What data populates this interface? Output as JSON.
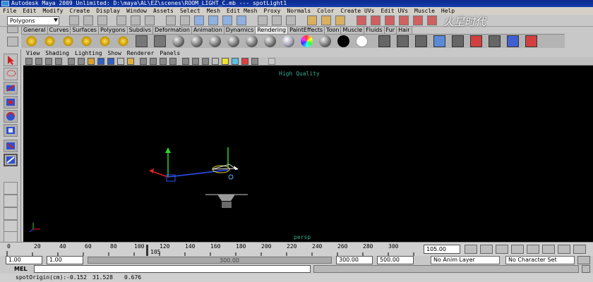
{
  "window": {
    "title": "Autodesk Maya 2009 Unlimited: D:\\maya\\AL\\EZ\\scenes\\ROOM_LIGHT_C.mb    ---    spotLight1"
  },
  "menubar": [
    "File",
    "Edit",
    "Modify",
    "Create",
    "Display",
    "Window",
    "Assets",
    "Select",
    "Mesh",
    "Edit Mesh",
    "Proxy",
    "Normals",
    "Color",
    "Create UVs",
    "Edit UVs",
    "Muscle",
    "Help"
  ],
  "statusline": {
    "mode": "Polygons"
  },
  "shelf": {
    "tabs": [
      "General",
      "Curves",
      "Surfaces",
      "Polygons",
      "Subdivs",
      "Deformation",
      "Animation",
      "Dynamics",
      "Rendering",
      "PaintEffects",
      "Toon",
      "Muscle",
      "Fluids",
      "Fur",
      "Hair"
    ],
    "active_tab": "Rendering"
  },
  "panel": {
    "menu": [
      "View",
      "Shading",
      "Lighting",
      "Show",
      "Renderer",
      "Panels"
    ],
    "renderer_label": "High Quality",
    "camera_label": "persp"
  },
  "timeline": {
    "ticks": [
      "0",
      "20",
      "40",
      "60",
      "80",
      "100",
      "120",
      "140",
      "160",
      "180",
      "200",
      "220",
      "240",
      "260",
      "280",
      "300"
    ],
    "current_marker": "105",
    "current_frame": "105.00"
  },
  "range": {
    "start": "1.00",
    "playback_start": "1.00",
    "slider_label": "300.00",
    "playback_end": "300.00",
    "end": "500.00",
    "anim_layer": "No Anim Layer",
    "character_set": "No Character Set"
  },
  "cmdline": {
    "label": "MEL"
  },
  "helpline": {
    "label": "spotOrigin(cm):",
    "x": "-0.152",
    "y": "31.528",
    "z": "0.676"
  },
  "watermark": "火星时代",
  "colors": {
    "viewport_bg": "#000000",
    "title_bg": "#143db0",
    "manip_green": "#2ad42a",
    "manip_blue": "#3050ff",
    "manip_red": "#e02020",
    "manip_yellow": "#f0e030"
  }
}
